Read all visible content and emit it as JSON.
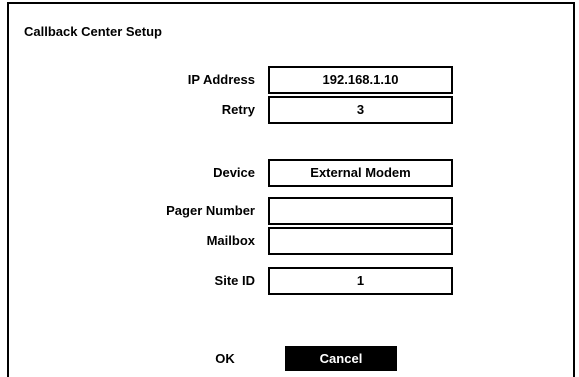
{
  "dialog": {
    "title": "Callback Center Setup",
    "fields": {
      "ip_address": {
        "label": "IP Address",
        "value": "192.168.1.10"
      },
      "retry": {
        "label": "Retry",
        "value": "3"
      },
      "device": {
        "label": "Device",
        "value": "External Modem"
      },
      "pager_number": {
        "label": "Pager Number",
        "value": ""
      },
      "mailbox": {
        "label": "Mailbox",
        "value": ""
      },
      "site_id": {
        "label": "Site ID",
        "value": "1"
      }
    },
    "buttons": {
      "ok": "OK",
      "cancel": "Cancel"
    }
  }
}
